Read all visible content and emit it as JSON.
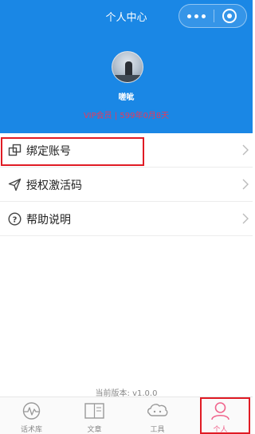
{
  "navbar": {
    "title": "个人中心"
  },
  "profile": {
    "nickname": "嗟呲",
    "vip_text": "VIP会员 | 599年0月8天"
  },
  "menu": {
    "items": [
      {
        "label": "绑定账号",
        "icon": "link-accounts-icon"
      },
      {
        "label": "授权激活码",
        "icon": "send-icon"
      },
      {
        "label": "帮助说明",
        "icon": "help-icon"
      }
    ]
  },
  "version_text": "当前版本: v1.0.0",
  "tabs": [
    {
      "label": "话术库",
      "icon": "chart-icon",
      "active": false
    },
    {
      "label": "文章",
      "icon": "book-icon",
      "active": false
    },
    {
      "label": "工具",
      "icon": "chat-cloud-icon",
      "active": false
    },
    {
      "label": "个人",
      "icon": "person-icon",
      "active": true
    }
  ],
  "colors": {
    "primary": "#1a87e5",
    "vip": "#e63a5c",
    "tab_active": "#f0648c",
    "highlight": "#e01b24"
  }
}
